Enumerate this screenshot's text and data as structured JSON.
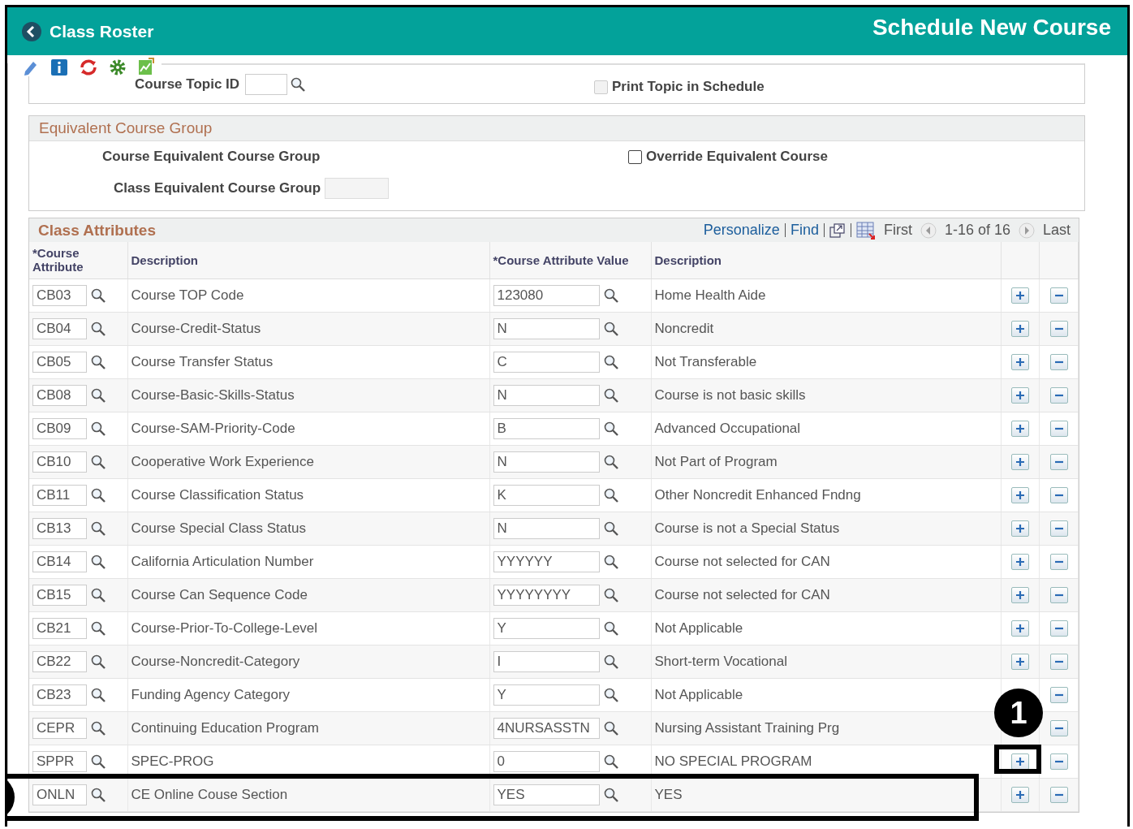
{
  "header": {
    "back_label": "Class Roster",
    "title": "Schedule New Course"
  },
  "topic": {
    "label": "Course Topic ID",
    "print_topic": {
      "label": "Print Topic in Schedule",
      "checked": false,
      "disabled": true
    }
  },
  "equivalent_group": {
    "title": "Equivalent Course Group",
    "course_label": "Course Equivalent Course Group",
    "class_label": "Class Equivalent Course Group",
    "override": {
      "label": "Override Equivalent Course",
      "checked": false,
      "disabled": false
    }
  },
  "class_attributes": {
    "title": "Class Attributes",
    "toolbar": {
      "personalize": "Personalize",
      "find": "Find",
      "first": "First",
      "range": "1-16 of 16",
      "last": "Last"
    },
    "columns": [
      "*Course Attribute",
      "Description",
      "*Course Attribute Value",
      "Description"
    ],
    "rows": [
      {
        "attribute": "CB03",
        "description": "Course TOP Code",
        "value": "123080",
        "value_description": "Home Health Aide"
      },
      {
        "attribute": "CB04",
        "description": "Course-Credit-Status",
        "value": "N",
        "value_description": "Noncredit"
      },
      {
        "attribute": "CB05",
        "description": "Course Transfer Status",
        "value": "C",
        "value_description": "Not Transferable"
      },
      {
        "attribute": "CB08",
        "description": "Course-Basic-Skills-Status",
        "value": "N",
        "value_description": "Course is not basic skills"
      },
      {
        "attribute": "CB09",
        "description": "Course-SAM-Priority-Code",
        "value": "B",
        "value_description": "Advanced Occupational"
      },
      {
        "attribute": "CB10",
        "description": "Cooperative Work Experience",
        "value": "N",
        "value_description": "Not Part of Program"
      },
      {
        "attribute": "CB11",
        "description": "Course Classification Status",
        "value": "K",
        "value_description": "Other Noncredit Enhanced Fndng"
      },
      {
        "attribute": "CB13",
        "description": "Course Special Class Status",
        "value": "N",
        "value_description": "Course is not a Special Status"
      },
      {
        "attribute": "CB14",
        "description": "California Articulation Number",
        "value": "YYYYYY",
        "value_description": "Course not selected for CAN"
      },
      {
        "attribute": "CB15",
        "description": "Course Can Sequence Code",
        "value": "YYYYYYYY",
        "value_description": "Course not selected for CAN"
      },
      {
        "attribute": "CB21",
        "description": "Course-Prior-To-College-Level",
        "value": "Y",
        "value_description": "Not Applicable"
      },
      {
        "attribute": "CB22",
        "description": "Course-Noncredit-Category",
        "value": "I",
        "value_description": "Short-term Vocational"
      },
      {
        "attribute": "CB23",
        "description": "Funding Agency Category",
        "value": "Y",
        "value_description": "Not Applicable"
      },
      {
        "attribute": "CEPR",
        "description": "Continuing Education Program",
        "value": "4NURSASSTN",
        "value_description": "Nursing Assistant Training Prg"
      },
      {
        "attribute": "SPPR",
        "description": "SPEC-PROG",
        "value": "0",
        "value_description": "NO SPECIAL PROGRAM",
        "add_button_boxed": true,
        "badge": "1"
      },
      {
        "attribute": "ONLN",
        "description": "CE Online Couse Section",
        "value": "YES",
        "value_description": "YES",
        "row_boxed": true
      }
    ]
  }
}
